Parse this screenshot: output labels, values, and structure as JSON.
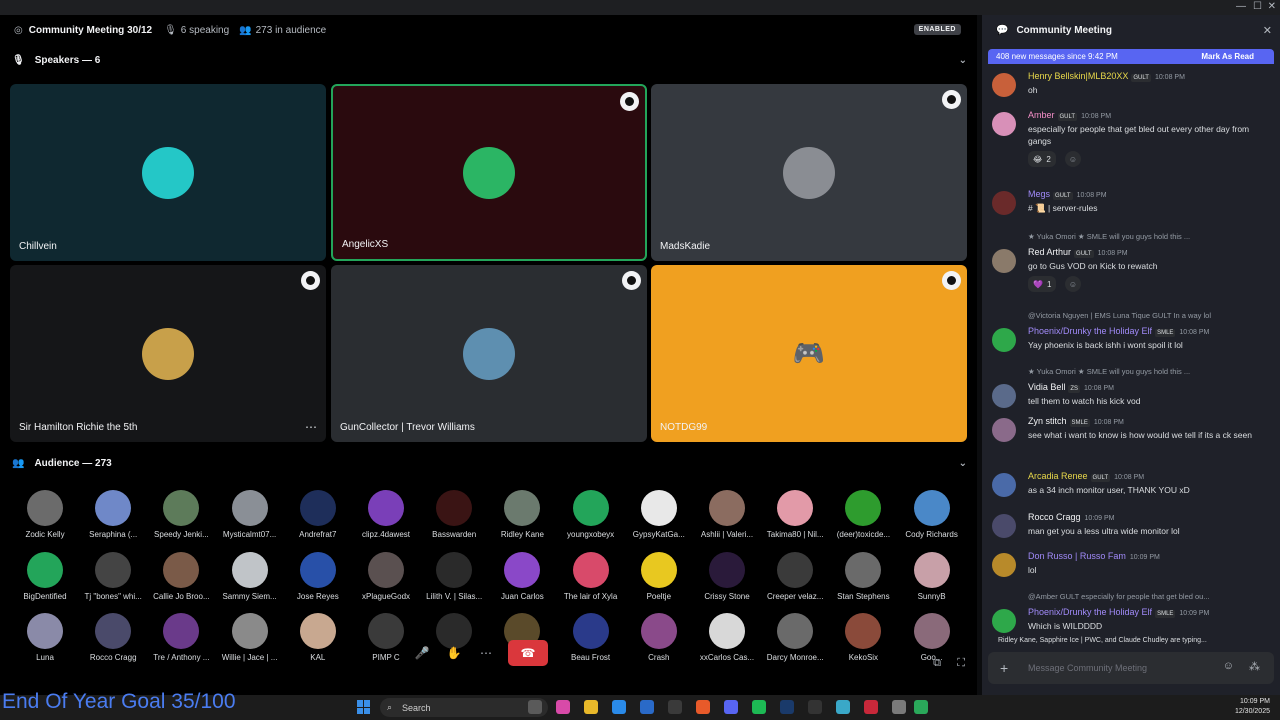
{
  "stage": {
    "title": "Community Meeting 30/12",
    "speaking": "6 speaking",
    "audience_count": "273 in audience",
    "status_badge": "ENABLED",
    "speakers_heading": "Speakers — 6",
    "audience_heading": "Audience — 273"
  },
  "speakers": [
    {
      "name": "Chillvein",
      "bg": "#0f2830",
      "avatar": "#24c7c7"
    },
    {
      "name": "AngelicXS",
      "bg": "#2a0a0e",
      "avatar": "#2bb564"
    },
    {
      "name": "MadsKadie",
      "bg": "#35393f",
      "avatar": "#8a8d93"
    },
    {
      "name": "Sir Hamilton Richie the 5th",
      "bg": "#151618",
      "avatar": "#c8a04a"
    },
    {
      "name": "GunCollector | Trevor Williams",
      "bg": "#2a2d31",
      "avatar": "#5e8fb0"
    },
    {
      "name": "NOTDG99",
      "bg": "#f0a020",
      "avatar": "#f0a020"
    }
  ],
  "audience": [
    {
      "name": "Zodic Kelly",
      "color": "#6b6b6b"
    },
    {
      "name": "Seraphina (...",
      "color": "#6f88c8"
    },
    {
      "name": "Speedy Jenki...",
      "color": "#5d7b5a"
    },
    {
      "name": "Mysticalmt07...",
      "color": "#8a8f96"
    },
    {
      "name": "Andrefrat7",
      "color": "#1e2e5a"
    },
    {
      "name": "clipz.4dawest",
      "color": "#7a3fb8"
    },
    {
      "name": "Basswarden",
      "color": "#3a1414"
    },
    {
      "name": "Ridley Kane",
      "color": "#6b7a6e"
    },
    {
      "name": "youngxobeyx",
      "color": "#23a55a"
    },
    {
      "name": "GypsyKatGa...",
      "color": "#e8e8e8"
    },
    {
      "name": "Ashlii | Valeri...",
      "color": "#8b6c60"
    },
    {
      "name": "Takima80 | Nil...",
      "color": "#e29aa8"
    },
    {
      "name": "(deer)toxicde...",
      "color": "#2e9c2e"
    },
    {
      "name": "Cody Richards",
      "color": "#4a88c8"
    },
    {
      "name": "BigDentified",
      "color": "#23a55a"
    },
    {
      "name": "Tj \"bones\" whi...",
      "color": "#444"
    },
    {
      "name": "Callie Jo Broo...",
      "color": "#7a5a48"
    },
    {
      "name": "Sammy Siem...",
      "color": "#c0c4c8"
    },
    {
      "name": "Jose Reyes",
      "color": "#2850a8"
    },
    {
      "name": "xPlagueGodx",
      "color": "#5a5050"
    },
    {
      "name": "Lilith V. | Silas...",
      "color": "#2a2a2a"
    },
    {
      "name": "Juan Carlos",
      "color": "#8a48c8"
    },
    {
      "name": "The lair of Xyla",
      "color": "#d84a6a"
    },
    {
      "name": "Poeltje",
      "color": "#e8c820"
    },
    {
      "name": "Crissy Stone",
      "color": "#2a1a3a"
    },
    {
      "name": "Creeper velaz...",
      "color": "#3a3a3a"
    },
    {
      "name": "Stan Stephens",
      "color": "#6a6a6a"
    },
    {
      "name": "SunnyB",
      "color": "#c8a0a8"
    },
    {
      "name": "Luna",
      "color": "#8a8aa8"
    },
    {
      "name": "Rocco Cragg",
      "color": "#4a4a6a"
    },
    {
      "name": "Tre / Anthony ...",
      "color": "#6a3a8a"
    },
    {
      "name": "Willie | Jace | ...",
      "color": "#8a8a8a"
    },
    {
      "name": "KAL",
      "color": "#c8a890"
    },
    {
      "name": "PIMP C",
      "color": "#3a3a3a"
    },
    {
      "name": "",
      "color": "#2a2a2a"
    },
    {
      "name": "",
      "color": "#5a4a2a"
    },
    {
      "name": "Beau Frost",
      "color": "#2a3a8a"
    },
    {
      "name": "Crash",
      "color": "#8a4a8a"
    },
    {
      "name": "xxCarlos Cas...",
      "color": "#d8d8d8"
    },
    {
      "name": "Darcy Monroe...",
      "color": "#6a6a6a"
    },
    {
      "name": "KekoSix",
      "color": "#8a4a3a"
    },
    {
      "name": "Goo...",
      "color": "#8a6a7a"
    }
  ],
  "chat": {
    "title": "Community Meeting",
    "new_messages": "408 new messages since 9:42 PM",
    "mark_as_read": "Mark As Read",
    "placeholder": "Message Community Meeting",
    "typing": "Ridley Kane, Sapphire Ice | PWC, and Claude Chudley are typing...",
    "messages": [
      {
        "user": "Henry Bellskin|MLB20XX",
        "color": "#e8d84a",
        "tag": "GULT",
        "time": "10:08 PM",
        "text": "oh",
        "avatar": "#c8603a"
      },
      {
        "user": "Amber",
        "color": "#f48fc8",
        "tag": "GULT",
        "time": "10:08 PM",
        "text": "especially for people that get bled out every other day from gangs",
        "avatar": "#d890b8",
        "reaction": "2"
      },
      {
        "user": "Megs",
        "color": "#a08af8",
        "tag": "GULT",
        "time": "10:08 PM",
        "text": "# 📜 | server-rules",
        "avatar": "#6a2a2a"
      },
      {
        "reply": "★ Yuka Omori ★ SMLE will you guys hold this ...",
        "user": "Red Arthur",
        "color": "#f2f3f5",
        "tag": "GULT",
        "time": "10:08 PM",
        "text": "go to Gus VOD on Kick to rewatch",
        "avatar": "#8a7a6a",
        "reaction": "1"
      },
      {
        "reply": "@Victoria Nguyen | EMS Luna Tique GULT In a way lol",
        "user": "Phoenix/Drunky the Holiday Elf",
        "color": "#a08af8",
        "tag": "SMLE",
        "time": "10:08 PM",
        "text": "Yay phoenix is back ishh i wont spoil it lol",
        "avatar": "#2ea84a"
      },
      {
        "reply": "★ Yuka Omori ★ SMLE will you guys hold this ...",
        "user": "Vidia Bell",
        "color": "#f2f3f5",
        "tag": "ZS",
        "time": "10:08 PM",
        "text": "tell them to watch his kick vod",
        "avatar": "#5a6a8a"
      },
      {
        "user": "Zyn stitch",
        "color": "#f2f3f5",
        "tag": "SMLE",
        "time": "10:08 PM",
        "text": "see what i want to know is how would we tell if its a ck seen",
        "avatar": "#8a6a8a"
      },
      {
        "user": "Arcadia Renee",
        "color": "#e8d84a",
        "tag": "GULT",
        "time": "10:08 PM",
        "text": "as a 34 inch monitor user, THANK YOU xD",
        "avatar": "#4a6aa8"
      },
      {
        "user": "Rocco Cragg",
        "color": "#f2f3f5",
        "tag": "",
        "time": "10:09 PM",
        "text": "man get you a less ultra wide monitor lol",
        "avatar": "#4a4a6a"
      },
      {
        "user": "Don Russo | Russo Fam",
        "color": "#a08af8",
        "tag": "",
        "time": "10:09 PM",
        "text": "lol",
        "avatar": "#b88a2a"
      },
      {
        "reply": "@Amber GULT especially for people that get bled ou...",
        "user": "Phoenix/Drunky the Holiday Elf",
        "color": "#a08af8",
        "tag": "SMLE",
        "time": "10:09 PM",
        "text": "Which is WILDDDD",
        "avatar": "#2ea84a"
      }
    ]
  },
  "taskbar": {
    "overlay_text": "End Of Year Goal 35/100",
    "search": "Search",
    "time": "10:09 PM",
    "date": "12/30/2025"
  }
}
